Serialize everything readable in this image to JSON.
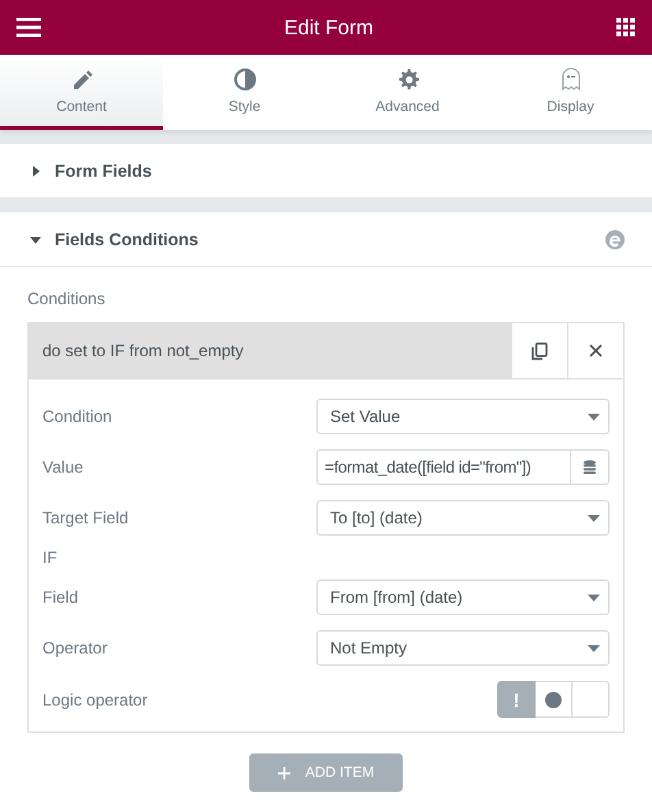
{
  "header": {
    "title": "Edit Form"
  },
  "tabs": [
    {
      "label": "Content",
      "kind": "pencil",
      "selected": true
    },
    {
      "label": "Style",
      "kind": "contrast",
      "selected": false
    },
    {
      "label": "Advanced",
      "kind": "gear",
      "selected": false
    },
    {
      "label": "Display",
      "kind": "ghost",
      "selected": false
    }
  ],
  "sections": [
    {
      "title": "Form Fields",
      "expanded": false,
      "badge": false
    },
    {
      "title": "Fields Conditions",
      "expanded": true,
      "badge": true
    }
  ],
  "conditions": {
    "label": "Conditions",
    "items": [
      {
        "title": "do set to IF from not_empty",
        "fields": [
          {
            "kind": "select",
            "label": "Condition",
            "value": "Set Value"
          },
          {
            "kind": "dynamic",
            "label": "Value",
            "value": "=format_date([field id=\"from\"])"
          },
          {
            "kind": "select",
            "label": "Target Field",
            "value": "To [to] (date)"
          },
          {
            "kind": "heading",
            "label": "IF"
          },
          {
            "kind": "select",
            "label": "Field",
            "value": "From [from] (date)"
          },
          {
            "kind": "select",
            "label": "Operator",
            "value": "Not Empty"
          },
          {
            "kind": "choose",
            "label": "Logic operator",
            "options": [
              {
                "kind": "text",
                "text": "!",
                "selected": true
              },
              {
                "kind": "dot",
                "selected": false
              },
              {
                "kind": "empty",
                "selected": false
              }
            ]
          }
        ]
      }
    ],
    "add_button": "ADD ITEM"
  }
}
